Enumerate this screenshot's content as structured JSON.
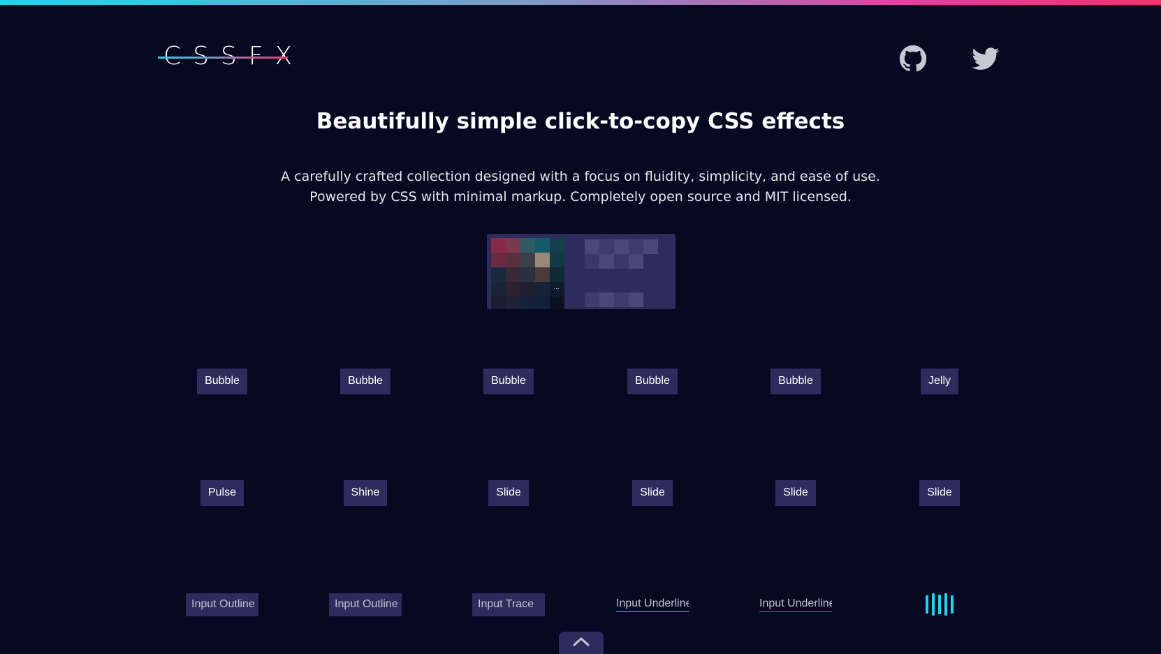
{
  "header": {
    "logo_text": "CSSFX",
    "github_icon": "github-icon",
    "twitter_icon": "twitter-icon"
  },
  "hero": {
    "title": "Beautifully simple click-to-copy CSS effects",
    "subtitle_line1": "A carefully crafted collection designed with a focus on fluidity, simplicity, and ease of use.",
    "subtitle_line2": "Powered by CSS with minimal markup. Completely open source and MIT licensed."
  },
  "promo": {
    "label": "...",
    "blurred": true
  },
  "grid": {
    "row1": [
      "Bubble",
      "Bubble",
      "Bubble",
      "Bubble",
      "Bubble",
      "Jelly"
    ],
    "row2": [
      "Pulse",
      "Shine",
      "Slide",
      "Slide",
      "Slide",
      "Slide"
    ],
    "row3": {
      "outline1": "Input Outline",
      "outline2": "Input Outline",
      "trace": "Input Trace",
      "underline1": "Input Underline",
      "underline2": "Input Underline",
      "loader_icon": "bars-loader-icon"
    }
  },
  "scroll_top_icon": "chevron-up-icon",
  "colors": {
    "background": "#070821",
    "button": "#2d2c5c",
    "cyan": "#22d3ee",
    "pink": "#f0346e"
  }
}
